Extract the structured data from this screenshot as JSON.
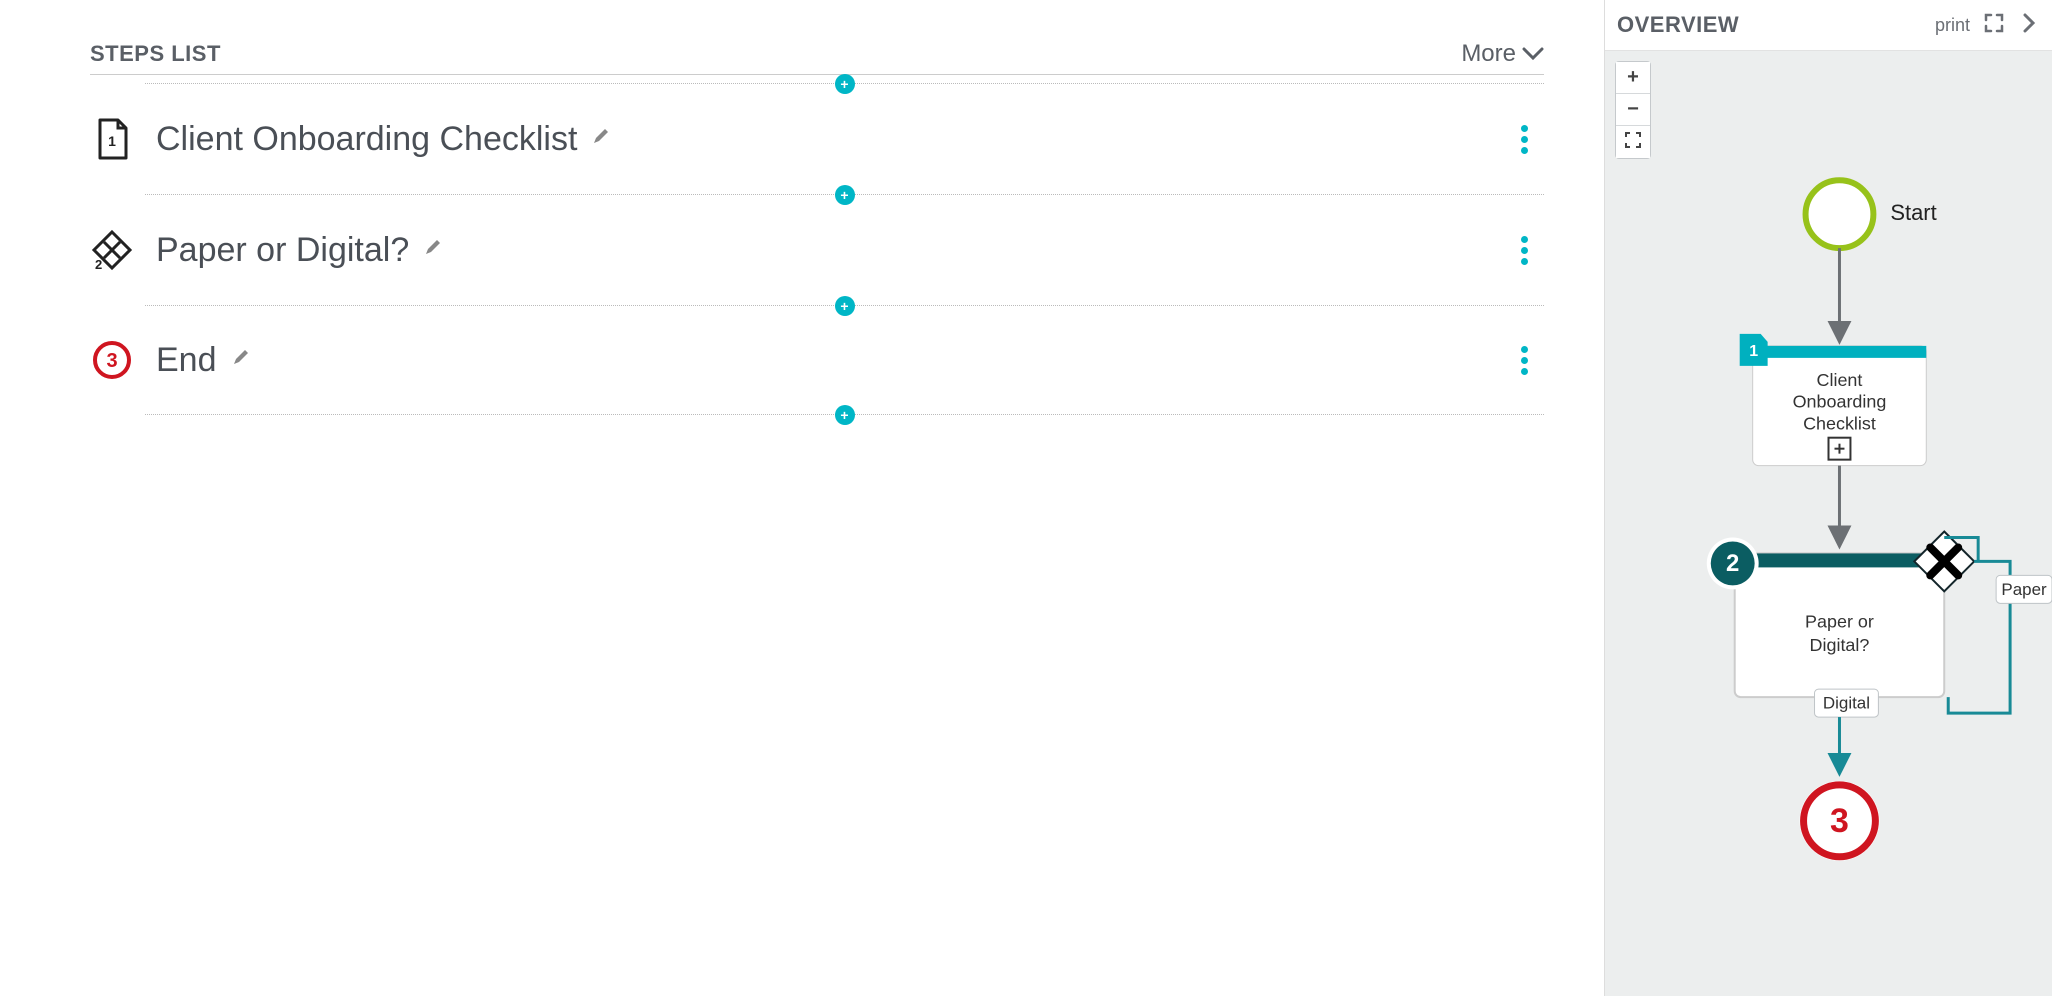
{
  "steps_list": {
    "title": "STEPS LIST",
    "more_label": "More",
    "steps": [
      {
        "num": "1",
        "kind": "form",
        "title": "Client Onboarding Checklist"
      },
      {
        "num": "2",
        "kind": "decision",
        "title": "Paper or Digital?"
      },
      {
        "num": "3",
        "kind": "end",
        "title": "End"
      }
    ]
  },
  "overview": {
    "title": "OVERVIEW",
    "print_label": "print",
    "start_label": "Start",
    "node1": {
      "badge": "1",
      "line1": "Client",
      "line2": "Onboarding",
      "line3": "Checklist"
    },
    "node2": {
      "badge": "2",
      "line1": "Paper or",
      "line2": "Digital?"
    },
    "branch_digital": "Digital",
    "branch_paper": "Paper",
    "end_badge": "3"
  }
}
